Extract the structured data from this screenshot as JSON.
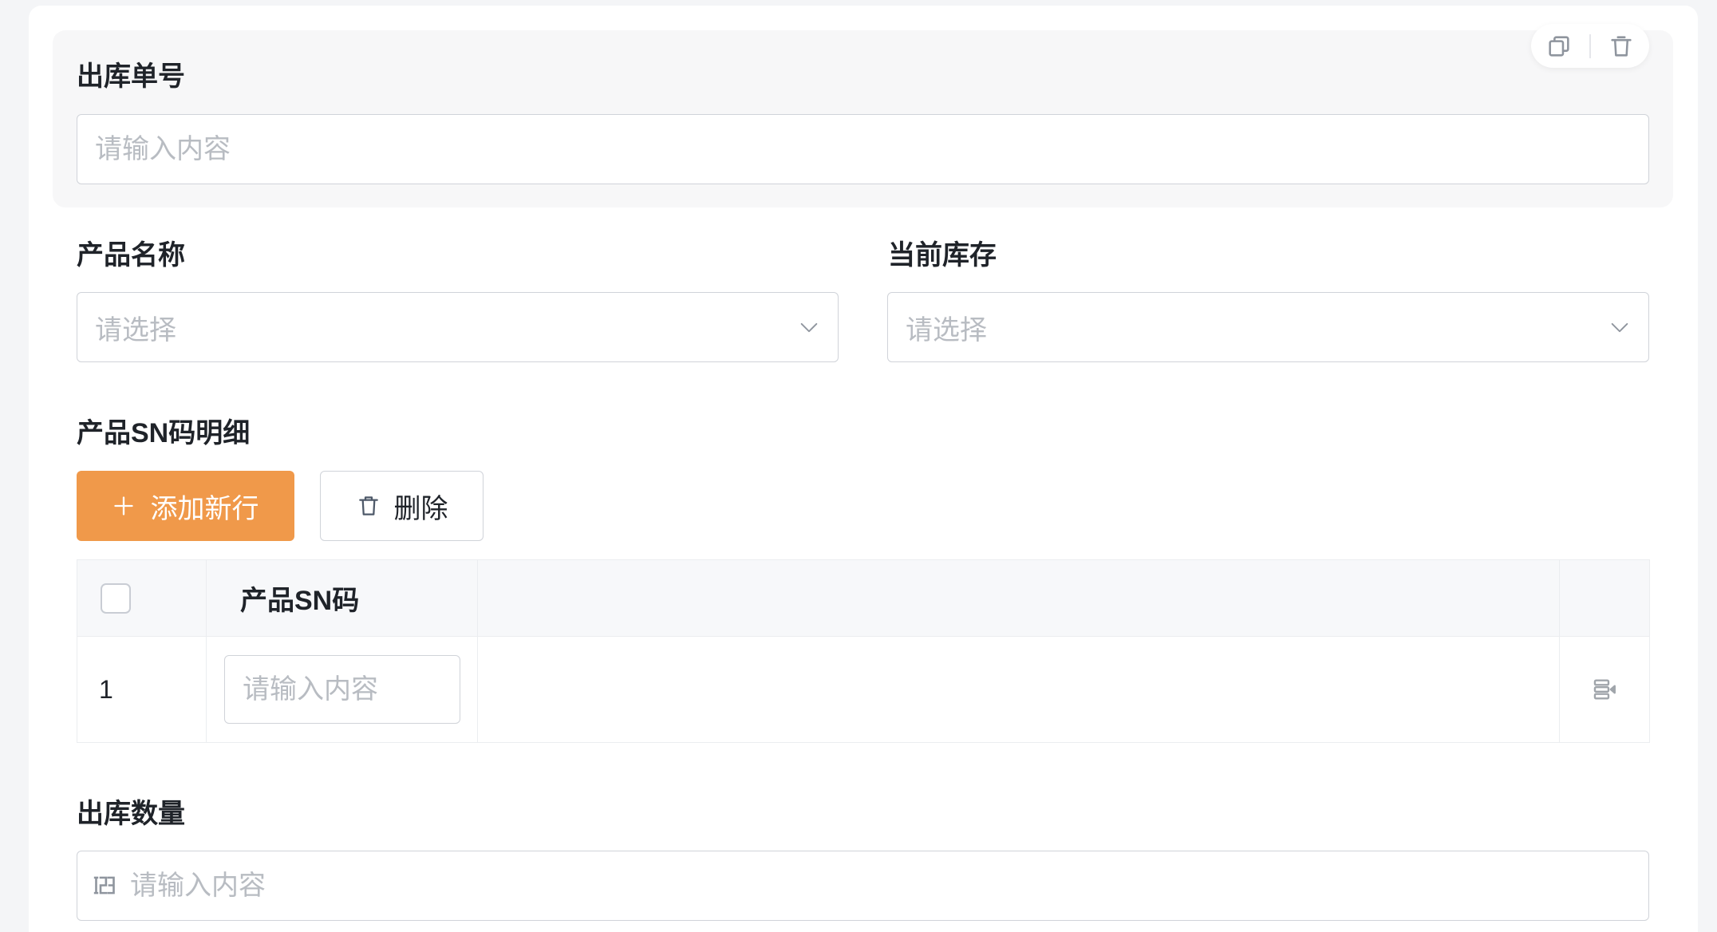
{
  "form": {
    "order_no": {
      "label": "出库单号",
      "placeholder": "请输入内容"
    },
    "product_name": {
      "label": "产品名称",
      "placeholder": "请选择"
    },
    "current_stock": {
      "label": "当前库存",
      "placeholder": "请选择"
    },
    "sn_detail": {
      "label": "产品SN码明细",
      "add_row_label": "添加新行",
      "delete_label": "删除",
      "table": {
        "columns": [
          "产品SN码"
        ],
        "rows": [
          {
            "index": "1",
            "sn_placeholder": "请输入内容"
          }
        ]
      }
    },
    "quantity": {
      "label": "出库数量",
      "placeholder": "请输入内容"
    }
  },
  "icons": {
    "field_toolbar": [
      "copy-icon",
      "trash-icon"
    ],
    "select": "chevron-down-icon",
    "add_row": "plus-icon",
    "delete": "trash-icon",
    "row_action": "row-operation-icon",
    "quantity_input": "number-input-icon"
  },
  "theme": {
    "primary": "#F0994A",
    "page_bg": "#F4F5F7",
    "text": "#1F2329",
    "placeholder": "#B8BCC2",
    "border": "#D0D3D9",
    "highlight_bg": "#F7F7F8",
    "icon": "#8F959E"
  }
}
